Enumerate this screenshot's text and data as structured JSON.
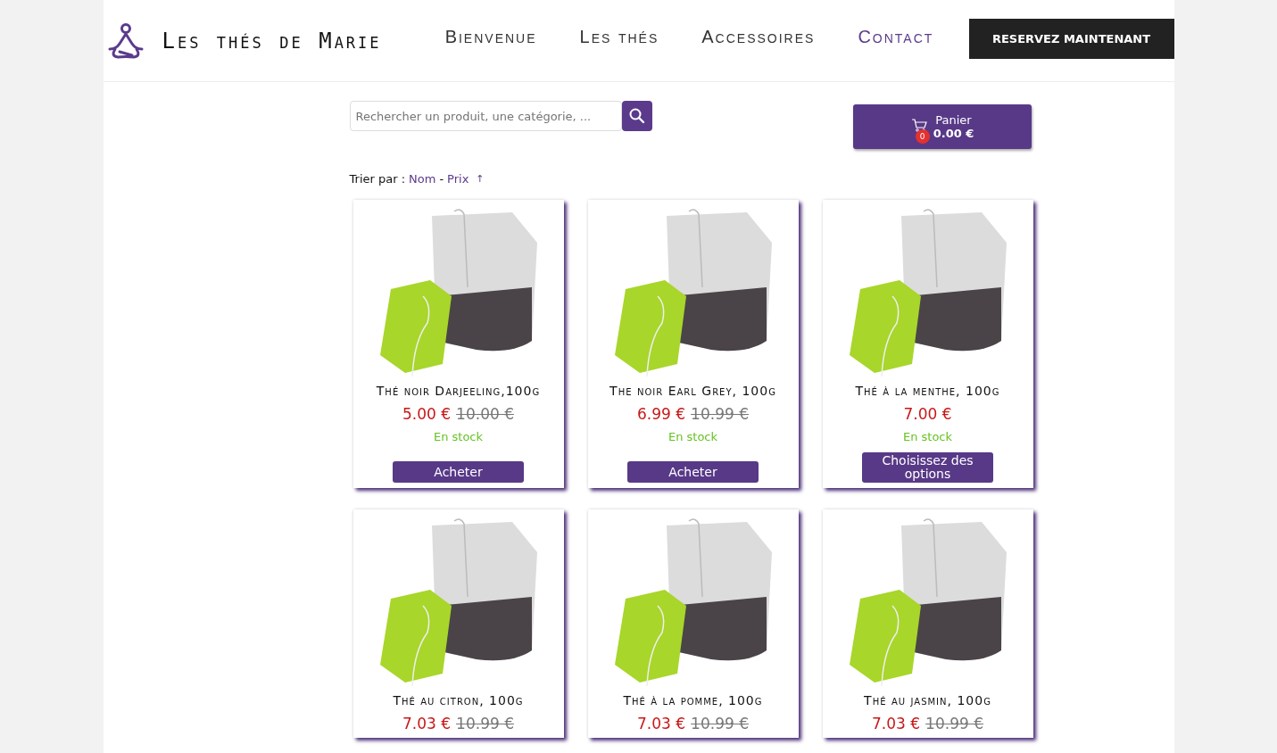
{
  "brand": "Les thés de Marie",
  "nav": [
    {
      "label": "Bienvenue",
      "selected": false
    },
    {
      "label": "Les thés",
      "selected": false
    },
    {
      "label": "Accessoires",
      "selected": false
    },
    {
      "label": "Contact",
      "selected": true
    }
  ],
  "cta": "RESERVEZ MAINTENANT",
  "search": {
    "placeholder": "Rechercher un produit, une catégorie, ..."
  },
  "cart": {
    "label": "Panier",
    "total": "0.00 €",
    "count": "0"
  },
  "sort": {
    "label": "Trier par :",
    "options": [
      "Nom",
      "Prix"
    ],
    "separator": "-",
    "arrow": "↑"
  },
  "products": [
    {
      "name": "Thé noir Darjeeling,100g",
      "price": "5.00 €",
      "old_price": "10.00 €",
      "stock": "En stock",
      "button": "Acheter"
    },
    {
      "name": "The noir Earl Grey, 100g",
      "price": "6.99 €",
      "old_price": "10.99 €",
      "stock": "En stock",
      "button": "Acheter"
    },
    {
      "name": "Thé à la menthe, 100g",
      "price": "7.00 €",
      "stock": "En stock",
      "button": "Choisissez des options"
    },
    {
      "name": "Thé au citron, 100g",
      "price": "7.03 €",
      "old_price": "10.99 €"
    },
    {
      "name": "Thé à la pomme, 100g",
      "price": "7.03 €",
      "old_price": "10.99 €"
    },
    {
      "name": "Thé au jasmin, 100g",
      "price": "7.03 €",
      "old_price": "10.99 €"
    }
  ]
}
